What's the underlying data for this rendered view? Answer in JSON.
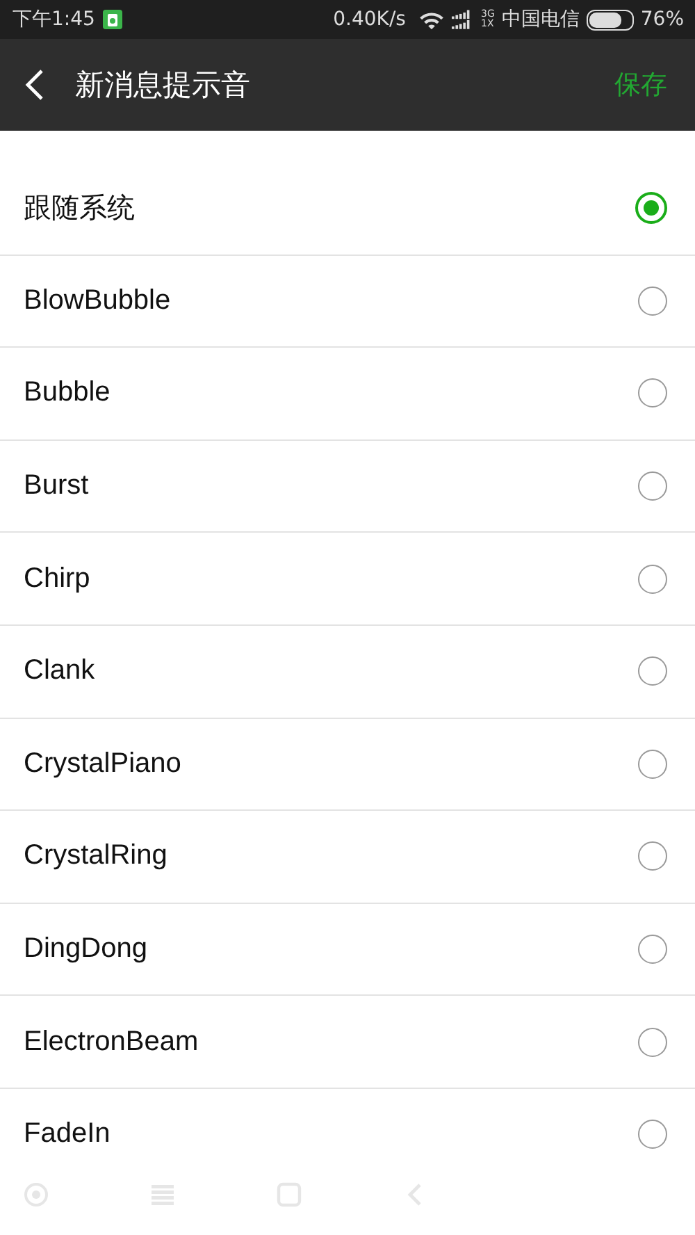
{
  "status_bar": {
    "time": "下午1:45",
    "speed": "0.40K/s",
    "network_top": "3G",
    "network_bottom": "1X",
    "carrier": "中国电信",
    "battery": "76%"
  },
  "toolbar": {
    "title": "新消息提示音",
    "action": "保存"
  },
  "options": [
    {
      "label": "跟随系统",
      "selected": true
    },
    {
      "label": "BlowBubble",
      "selected": false
    },
    {
      "label": "Bubble",
      "selected": false
    },
    {
      "label": "Burst",
      "selected": false
    },
    {
      "label": "Chirp",
      "selected": false
    },
    {
      "label": "Clank",
      "selected": false
    },
    {
      "label": "CrystalPiano",
      "selected": false
    },
    {
      "label": "CrystalRing",
      "selected": false
    },
    {
      "label": "DingDong",
      "selected": false
    },
    {
      "label": "ElectronBeam",
      "selected": false
    },
    {
      "label": "FadeIn",
      "selected": false
    }
  ]
}
